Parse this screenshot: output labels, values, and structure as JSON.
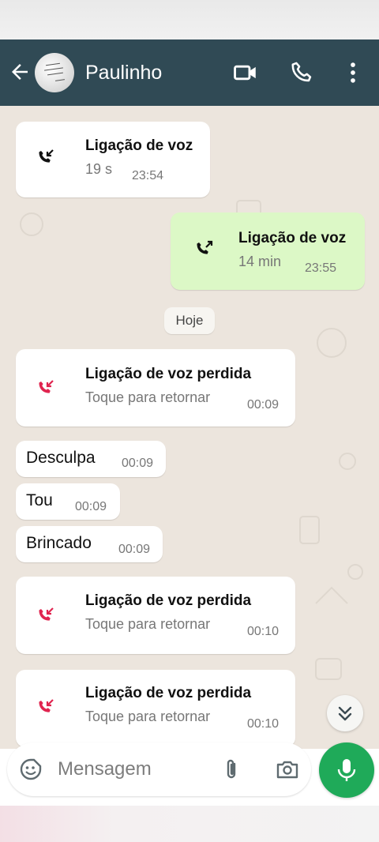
{
  "header": {
    "contact_name": "Paulinho",
    "back_icon": "arrow-left-icon",
    "video_icon": "video-camera-icon",
    "call_icon": "phone-icon",
    "menu_icon": "more-vertical-icon",
    "color": "#304a55"
  },
  "messages": {
    "call1": {
      "title": "Ligação de voz",
      "sub": "19 s",
      "time": "23:54",
      "icon": "incoming-call-icon",
      "direction": "incoming"
    },
    "call2": {
      "title": "Ligação de voz",
      "sub": "14 min",
      "time": "23:55",
      "icon": "outgoing-call-icon",
      "direction": "outgoing"
    },
    "date_chip": "Hoje",
    "missed1": {
      "title": "Ligação de voz perdida",
      "sub": "Toque para retornar",
      "time": "00:09",
      "icon": "missed-call-icon"
    },
    "text1": {
      "text": "Desculpa",
      "time": "00:09"
    },
    "text2": {
      "text": "Tou",
      "time": "00:09"
    },
    "text3": {
      "text": "Brincado",
      "time": "00:09"
    },
    "missed2": {
      "title": "Ligação de voz perdida",
      "sub": "Toque para retornar",
      "time": "00:10",
      "icon": "missed-call-icon"
    },
    "missed3": {
      "title": "Ligação de voz perdida",
      "sub": "Toque para retornar",
      "time": "00:10",
      "icon": "missed-call-icon"
    }
  },
  "composer": {
    "placeholder": "Mensagem",
    "emoji_icon": "emoji-icon",
    "attach_icon": "paperclip-icon",
    "camera_icon": "camera-icon",
    "mic_icon": "microphone-icon",
    "mic_color": "#1faa59"
  },
  "colors": {
    "outgoing_bubble": "#dcf8c6",
    "missed_call": "#e0244f",
    "chat_bg": "#ece5dd"
  }
}
